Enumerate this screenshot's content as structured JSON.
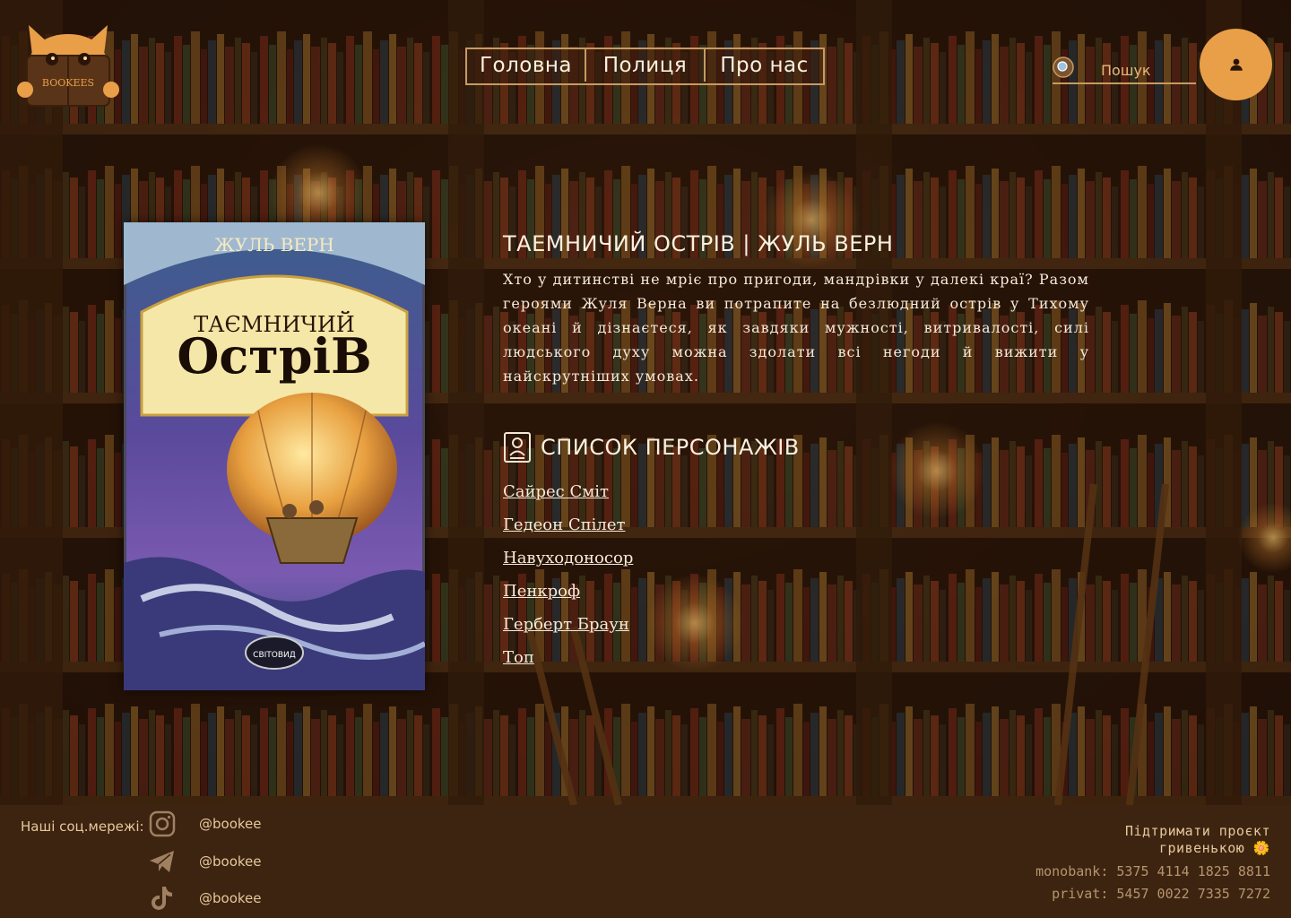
{
  "brand": {
    "logo_text": "BOOKEES"
  },
  "nav": {
    "items": [
      "Головна",
      "Полиця",
      "Про нас"
    ]
  },
  "search": {
    "placeholder": "Пошук"
  },
  "book": {
    "title": "ТАЕМНИЧИЙ ОСТРІВ | ЖУЛЬ ВЕРН",
    "description": "Хто у дитинстві не мріє про пригоди, мандрівки у далекі краї? Разом героями Жуля Верна ви потрапите на безлюдний острів у Тихому океані й дізнаєтеся, як завдяки мужності, витривалості, силі людського духу можна здолати всі негоди й вижити у найскрутніших умовах.",
    "cover": {
      "author": "ЖУЛЬ ВЕРН",
      "title_top": "ТАЄМНИЧИЙ",
      "title_bottom": "ОстріВ",
      "publisher": "СВІТОВИД"
    }
  },
  "characters": {
    "heading": "СПИСОК ПЕРСОНАЖІВ",
    "items": [
      "Сайрес Сміт",
      "Гедеон Спілет",
      "Навуходоносор",
      "Пенкроф",
      "Герберт Браун",
      "Топ"
    ]
  },
  "footer": {
    "social_label": "Наші соц.мережі:",
    "socials": [
      {
        "icon": "instagram-icon",
        "handle": "@bookee"
      },
      {
        "icon": "telegram-icon",
        "handle": "@bookee"
      },
      {
        "icon": "tiktok-icon",
        "handle": "@bookee"
      }
    ],
    "support_line1": "Підтримати проєкт",
    "support_line2": "гривенькою 🌼",
    "monobank": "monobank: 5375 4114 1825 8811",
    "privat": "privat: 5457 0022 7335 7272"
  },
  "colors": {
    "accent": "#e89f48",
    "footer_bg": "#3c2411",
    "nav_border": "#c79a62"
  }
}
